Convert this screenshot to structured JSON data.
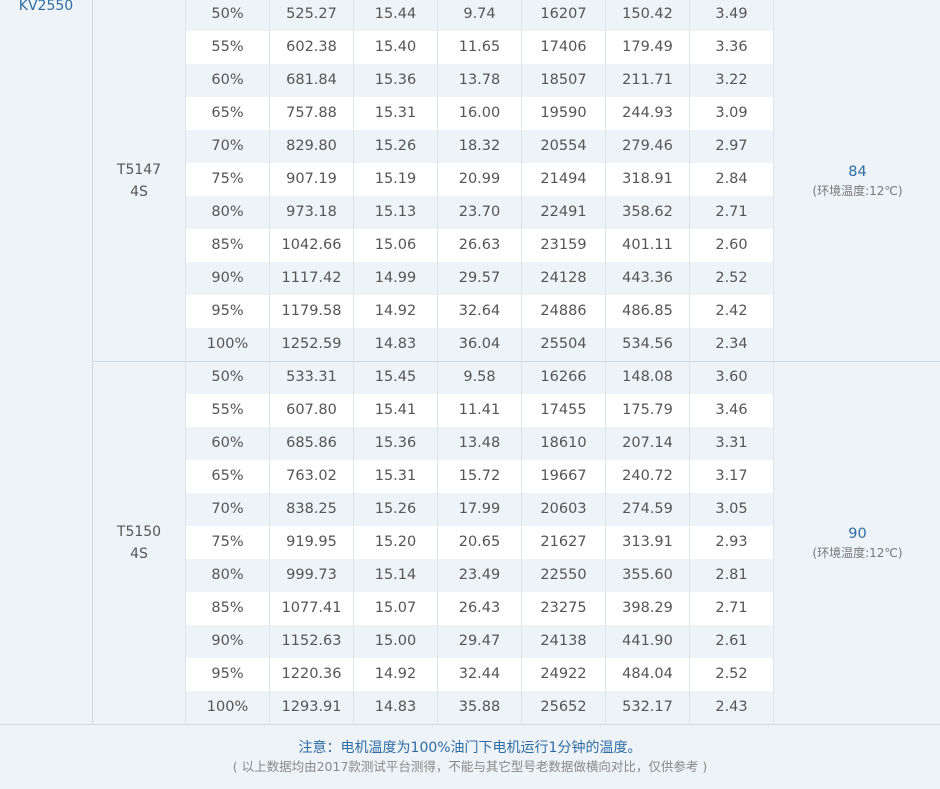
{
  "model": "KV2550",
  "groups": [
    {
      "propeller": [
        "T5147",
        "4S"
      ],
      "temperature": "84",
      "ambient": "(环境温度:12℃)",
      "rows": [
        [
          "50%",
          "525.27",
          "15.44",
          "9.74",
          "16207",
          "150.42",
          "3.49"
        ],
        [
          "55%",
          "602.38",
          "15.40",
          "11.65",
          "17406",
          "179.49",
          "3.36"
        ],
        [
          "60%",
          "681.84",
          "15.36",
          "13.78",
          "18507",
          "211.71",
          "3.22"
        ],
        [
          "65%",
          "757.88",
          "15.31",
          "16.00",
          "19590",
          "244.93",
          "3.09"
        ],
        [
          "70%",
          "829.80",
          "15.26",
          "18.32",
          "20554",
          "279.46",
          "2.97"
        ],
        [
          "75%",
          "907.19",
          "15.19",
          "20.99",
          "21494",
          "318.91",
          "2.84"
        ],
        [
          "80%",
          "973.18",
          "15.13",
          "23.70",
          "22491",
          "358.62",
          "2.71"
        ],
        [
          "85%",
          "1042.66",
          "15.06",
          "26.63",
          "23159",
          "401.11",
          "2.60"
        ],
        [
          "90%",
          "1117.42",
          "14.99",
          "29.57",
          "24128",
          "443.36",
          "2.52"
        ],
        [
          "95%",
          "1179.58",
          "14.92",
          "32.64",
          "24886",
          "486.85",
          "2.42"
        ],
        [
          "100%",
          "1252.59",
          "14.83",
          "36.04",
          "25504",
          "534.56",
          "2.34"
        ]
      ]
    },
    {
      "propeller": [
        "T5150",
        "4S"
      ],
      "temperature": "90",
      "ambient": "(环境温度:12℃)",
      "rows": [
        [
          "50%",
          "533.31",
          "15.45",
          "9.58",
          "16266",
          "148.08",
          "3.60"
        ],
        [
          "55%",
          "607.80",
          "15.41",
          "11.41",
          "17455",
          "175.79",
          "3.46"
        ],
        [
          "60%",
          "685.86",
          "15.36",
          "13.48",
          "18610",
          "207.14",
          "3.31"
        ],
        [
          "65%",
          "763.02",
          "15.31",
          "15.72",
          "19667",
          "240.72",
          "3.17"
        ],
        [
          "70%",
          "838.25",
          "15.26",
          "17.99",
          "20603",
          "274.59",
          "3.05"
        ],
        [
          "75%",
          "919.95",
          "15.20",
          "20.65",
          "21627",
          "313.91",
          "2.93"
        ],
        [
          "80%",
          "999.73",
          "15.14",
          "23.49",
          "22550",
          "355.60",
          "2.81"
        ],
        [
          "85%",
          "1077.41",
          "15.07",
          "26.43",
          "23275",
          "398.29",
          "2.71"
        ],
        [
          "90%",
          "1152.63",
          "15.00",
          "29.47",
          "24138",
          "441.90",
          "2.61"
        ],
        [
          "95%",
          "1220.36",
          "14.92",
          "32.44",
          "24922",
          "484.04",
          "2.52"
        ],
        [
          "100%",
          "1293.91",
          "14.83",
          "35.88",
          "25652",
          "532.17",
          "2.43"
        ]
      ]
    }
  ],
  "footer": {
    "note": "注意：电机温度为100%油门下电机运行1分钟的温度。",
    "sub": "( 以上数据均由2017款测试平台测得，不能与其它型号老数据做横向对比，仅供参考 )"
  },
  "colors": {
    "accent": "#2e6da4",
    "rowAlt": "#eef3f7",
    "rowBase": "#ffffff"
  }
}
